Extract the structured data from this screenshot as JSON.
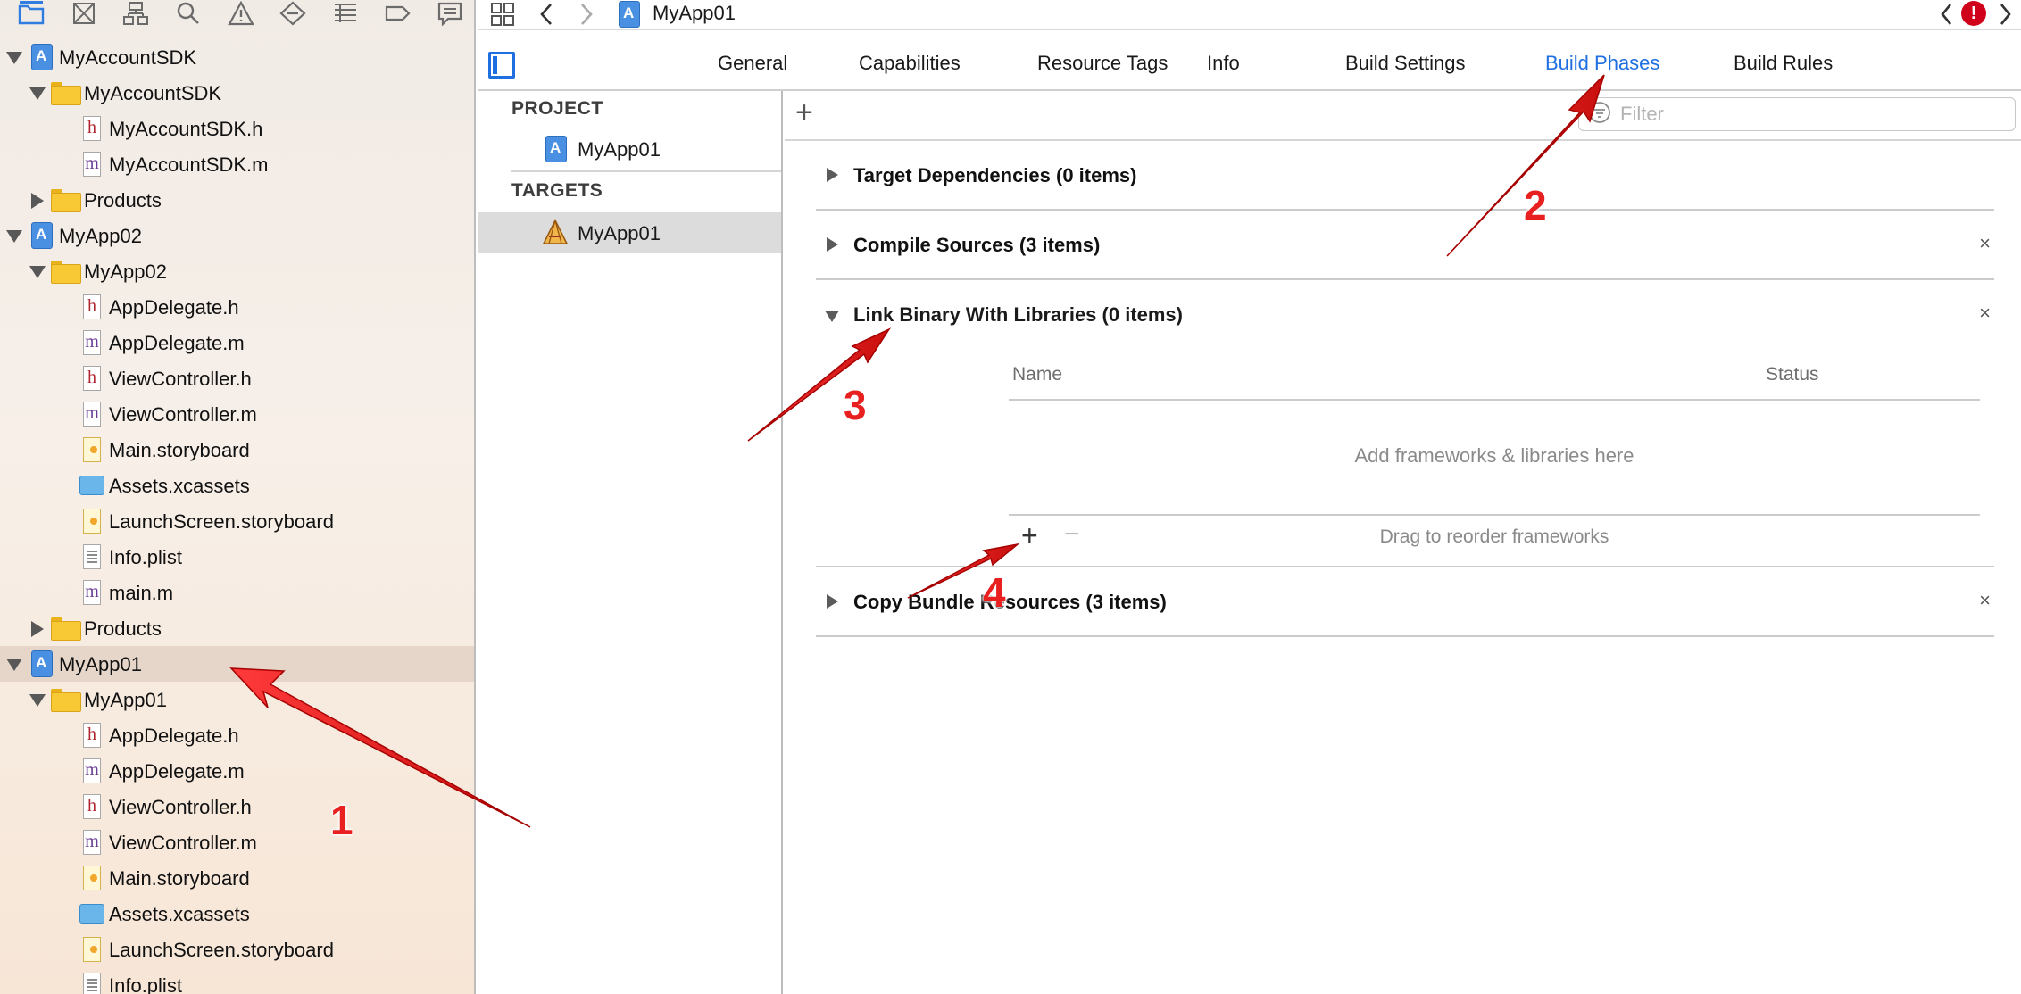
{
  "navigator": {
    "toolbar_icons": [
      "folder-icon",
      "source-control-icon",
      "symbol-hierarchy-icon",
      "search-icon",
      "warning-icon",
      "test-diamond-icon",
      "debug-list-icon",
      "breakpoint-icon",
      "report-icon"
    ],
    "items": [
      {
        "label": "MyAccountSDK",
        "icon": "project-icon",
        "level": 0,
        "state": "expanded"
      },
      {
        "label": "MyAccountSDK",
        "icon": "folder-icon",
        "level": 1,
        "state": "expanded"
      },
      {
        "label": "MyAccountSDK.h",
        "icon": "header-file-icon",
        "level": 2
      },
      {
        "label": "MyAccountSDK.m",
        "icon": "implementation-file-icon",
        "level": 2
      },
      {
        "label": "Products",
        "icon": "folder-icon",
        "level": 1,
        "state": "collapsed"
      },
      {
        "label": "MyApp02",
        "icon": "project-icon",
        "level": 0,
        "state": "expanded"
      },
      {
        "label": "MyApp02",
        "icon": "folder-icon",
        "level": 1,
        "state": "expanded"
      },
      {
        "label": "AppDelegate.h",
        "icon": "header-file-icon",
        "level": 2
      },
      {
        "label": "AppDelegate.m",
        "icon": "implementation-file-icon",
        "level": 2
      },
      {
        "label": "ViewController.h",
        "icon": "header-file-icon",
        "level": 2
      },
      {
        "label": "ViewController.m",
        "icon": "implementation-file-icon",
        "level": 2
      },
      {
        "label": "Main.storyboard",
        "icon": "storyboard-icon",
        "level": 2
      },
      {
        "label": "Assets.xcassets",
        "icon": "assets-icon",
        "level": 2
      },
      {
        "label": "LaunchScreen.storyboard",
        "icon": "storyboard-icon",
        "level": 2
      },
      {
        "label": "Info.plist",
        "icon": "plist-icon",
        "level": 2
      },
      {
        "label": "main.m",
        "icon": "implementation-file-icon",
        "level": 2
      },
      {
        "label": "Products",
        "icon": "folder-icon",
        "level": 1,
        "state": "collapsed"
      },
      {
        "label": "MyApp01",
        "icon": "project-icon",
        "level": 0,
        "state": "expanded",
        "selected": true
      },
      {
        "label": "MyApp01",
        "icon": "folder-icon",
        "level": 1,
        "state": "expanded"
      },
      {
        "label": "AppDelegate.h",
        "icon": "header-file-icon",
        "level": 2
      },
      {
        "label": "AppDelegate.m",
        "icon": "implementation-file-icon",
        "level": 2
      },
      {
        "label": "ViewController.h",
        "icon": "header-file-icon",
        "level": 2
      },
      {
        "label": "ViewController.m",
        "icon": "implementation-file-icon",
        "level": 2
      },
      {
        "label": "Main.storyboard",
        "icon": "storyboard-icon",
        "level": 2
      },
      {
        "label": "Assets.xcassets",
        "icon": "assets-icon",
        "level": 2
      },
      {
        "label": "LaunchScreen.storyboard",
        "icon": "storyboard-icon",
        "level": 2
      },
      {
        "label": "Info.plist",
        "icon": "plist-icon",
        "level": 2
      }
    ]
  },
  "toolbar": {
    "breadcrumb": "MyApp01",
    "error_badge": "!"
  },
  "tabs": [
    {
      "label": "General"
    },
    {
      "label": "Capabilities"
    },
    {
      "label": "Resource Tags"
    },
    {
      "label": "Info"
    },
    {
      "label": "Build Settings"
    },
    {
      "label": "Build Phases",
      "active": true
    },
    {
      "label": "Build Rules"
    }
  ],
  "targets_list": {
    "project_header": "PROJECT",
    "project_item": "MyApp01",
    "targets_header": "TARGETS",
    "target_item": "MyApp01"
  },
  "phases_toolbar": {
    "add": "+",
    "filter_placeholder": "Filter"
  },
  "phases": [
    {
      "title": "Target Dependencies (0 items)",
      "expanded": false,
      "closable": false
    },
    {
      "title": "Compile Sources (3 items)",
      "expanded": false,
      "closable": true
    },
    {
      "title": "Link Binary With Libraries (0 items)",
      "expanded": true,
      "closable": true
    },
    {
      "title": "Copy Bundle Resources (3 items)",
      "expanded": false,
      "closable": true
    }
  ],
  "link_table": {
    "col_name": "Name",
    "col_status": "Status",
    "empty_text": "Add frameworks & libraries here",
    "add": "+",
    "remove": "−",
    "reorder_hint": "Drag to reorder frameworks"
  },
  "close_glyph": "×",
  "annotations": [
    {
      "number": "1"
    },
    {
      "number": "2"
    },
    {
      "number": "3"
    },
    {
      "number": "4"
    }
  ],
  "colors": {
    "accent": "#1f6fe0",
    "annotation": "#e82020",
    "error": "#d0021b"
  }
}
